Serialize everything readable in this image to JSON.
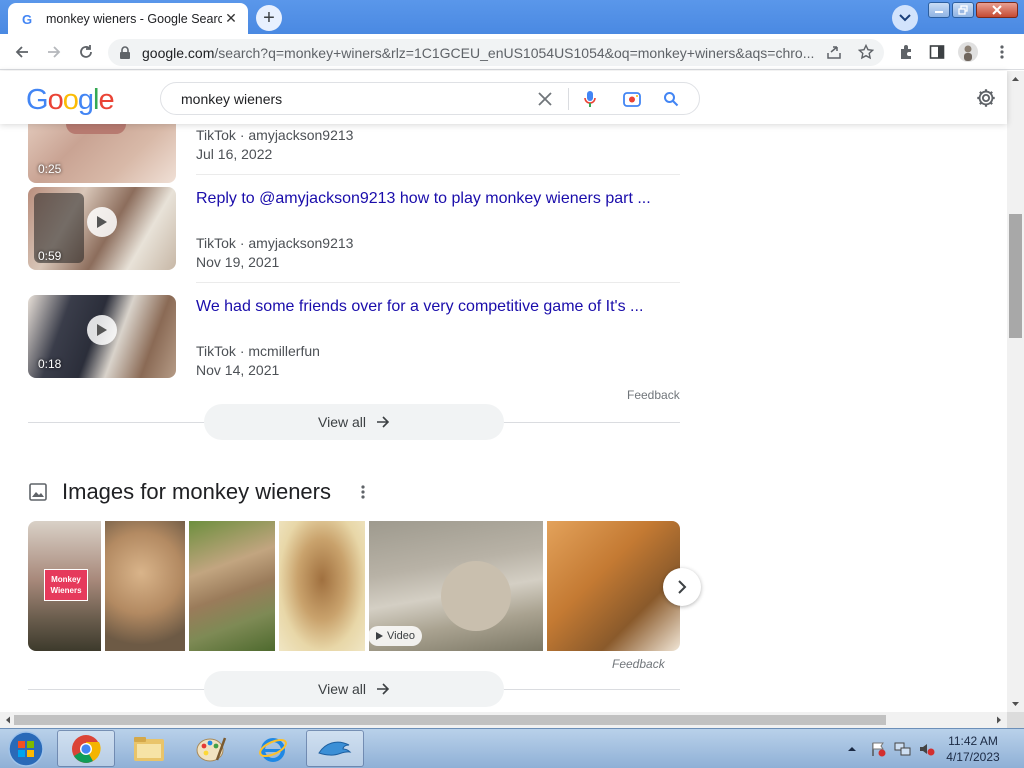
{
  "browser": {
    "tab_title": "monkey wieners - Google Search",
    "url_host": "google.com",
    "url_rest": "/search?q=monkey+winers&rlz=1C1GCEU_enUS1054US1054&oq=monkey+winers&aqs=chro..."
  },
  "google": {
    "logo_text": "Google",
    "query": "monkey wieners"
  },
  "videos": [
    {
      "duration": "0:25",
      "title": "",
      "source": "TikTok · amyjackson9213",
      "date": "Jul 16, 2022"
    },
    {
      "duration": "0:59",
      "title": "Reply to @amyjackson9213 how to play monkey wieners part ...",
      "source": "TikTok · amyjackson9213",
      "date": "Nov 19, 2021"
    },
    {
      "duration": "0:18",
      "title": "We had some friends over for a very competitive game of It's ...",
      "source": "TikTok · mcmillerfun",
      "date": "Nov 14, 2021"
    }
  ],
  "videos_feedback": "Feedback",
  "videos_view_all": "View all",
  "images_section": {
    "heading": "Images for monkey wieners",
    "thumb_text": "Monkey Wieners",
    "video_badge": "Video",
    "feedback": "Feedback",
    "view_all": "View all"
  },
  "taskbar": {
    "time": "11:42 AM",
    "date": "4/17/2023"
  },
  "colors": {
    "link": "#1a0dab",
    "chrome_frame": "#4f8ee6"
  }
}
